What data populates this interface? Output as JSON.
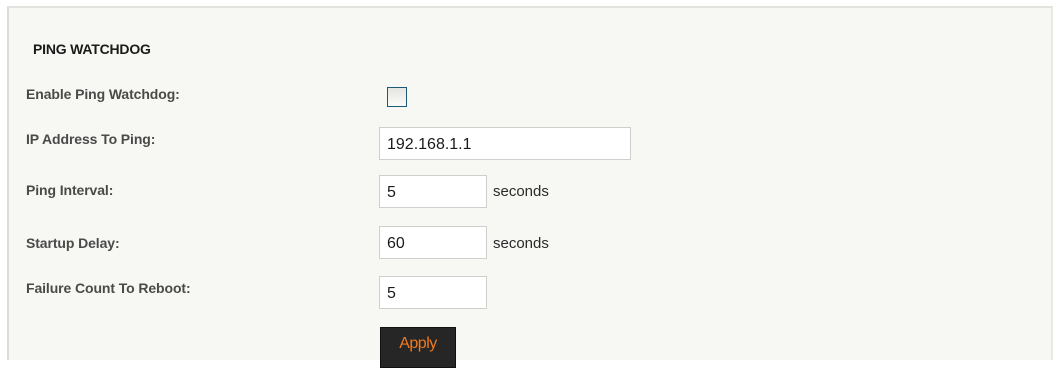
{
  "section": {
    "title": "PING WATCHDOG"
  },
  "fields": {
    "enable": {
      "label": "Enable Ping Watchdog:",
      "checked": false
    },
    "ip_address": {
      "label": "IP Address To Ping:",
      "value": "192.168.1.1"
    },
    "interval": {
      "label": "Ping Interval:",
      "value": "5",
      "unit": "seconds"
    },
    "startup_delay": {
      "label": "Startup Delay:",
      "value": "60",
      "unit": "seconds"
    },
    "failure_count": {
      "label": "Failure Count To Reboot:",
      "value": "5"
    }
  },
  "actions": {
    "apply_label": "Apply"
  },
  "colors": {
    "panel_background": "#f7f7f3",
    "button_background": "#262626",
    "button_text": "#f07a1e",
    "checkbox_border": "#1c5a7a"
  }
}
